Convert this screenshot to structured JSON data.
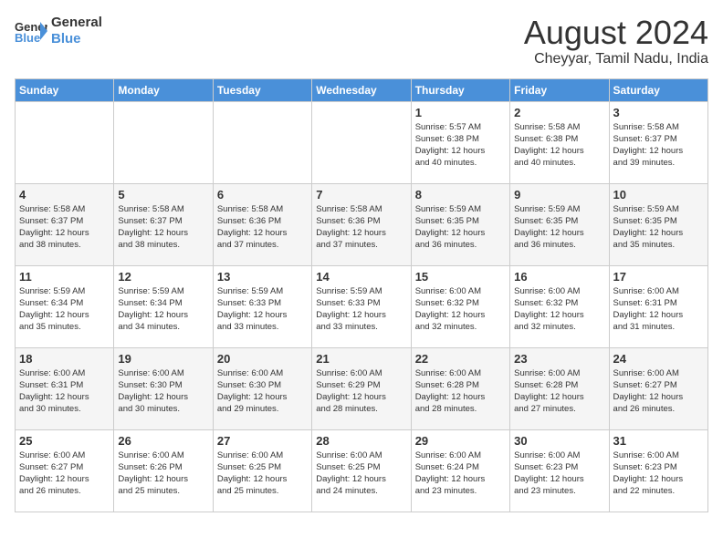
{
  "logo": {
    "line1": "General",
    "line2": "Blue"
  },
  "title": "August 2024",
  "subtitle": "Cheyyar, Tamil Nadu, India",
  "days_of_week": [
    "Sunday",
    "Monday",
    "Tuesday",
    "Wednesday",
    "Thursday",
    "Friday",
    "Saturday"
  ],
  "weeks": [
    [
      {
        "num": "",
        "info": ""
      },
      {
        "num": "",
        "info": ""
      },
      {
        "num": "",
        "info": ""
      },
      {
        "num": "",
        "info": ""
      },
      {
        "num": "1",
        "info": "Sunrise: 5:57 AM\nSunset: 6:38 PM\nDaylight: 12 hours\nand 40 minutes."
      },
      {
        "num": "2",
        "info": "Sunrise: 5:58 AM\nSunset: 6:38 PM\nDaylight: 12 hours\nand 40 minutes."
      },
      {
        "num": "3",
        "info": "Sunrise: 5:58 AM\nSunset: 6:37 PM\nDaylight: 12 hours\nand 39 minutes."
      }
    ],
    [
      {
        "num": "4",
        "info": "Sunrise: 5:58 AM\nSunset: 6:37 PM\nDaylight: 12 hours\nand 38 minutes."
      },
      {
        "num": "5",
        "info": "Sunrise: 5:58 AM\nSunset: 6:37 PM\nDaylight: 12 hours\nand 38 minutes."
      },
      {
        "num": "6",
        "info": "Sunrise: 5:58 AM\nSunset: 6:36 PM\nDaylight: 12 hours\nand 37 minutes."
      },
      {
        "num": "7",
        "info": "Sunrise: 5:58 AM\nSunset: 6:36 PM\nDaylight: 12 hours\nand 37 minutes."
      },
      {
        "num": "8",
        "info": "Sunrise: 5:59 AM\nSunset: 6:35 PM\nDaylight: 12 hours\nand 36 minutes."
      },
      {
        "num": "9",
        "info": "Sunrise: 5:59 AM\nSunset: 6:35 PM\nDaylight: 12 hours\nand 36 minutes."
      },
      {
        "num": "10",
        "info": "Sunrise: 5:59 AM\nSunset: 6:35 PM\nDaylight: 12 hours\nand 35 minutes."
      }
    ],
    [
      {
        "num": "11",
        "info": "Sunrise: 5:59 AM\nSunset: 6:34 PM\nDaylight: 12 hours\nand 35 minutes."
      },
      {
        "num": "12",
        "info": "Sunrise: 5:59 AM\nSunset: 6:34 PM\nDaylight: 12 hours\nand 34 minutes."
      },
      {
        "num": "13",
        "info": "Sunrise: 5:59 AM\nSunset: 6:33 PM\nDaylight: 12 hours\nand 33 minutes."
      },
      {
        "num": "14",
        "info": "Sunrise: 5:59 AM\nSunset: 6:33 PM\nDaylight: 12 hours\nand 33 minutes."
      },
      {
        "num": "15",
        "info": "Sunrise: 6:00 AM\nSunset: 6:32 PM\nDaylight: 12 hours\nand 32 minutes."
      },
      {
        "num": "16",
        "info": "Sunrise: 6:00 AM\nSunset: 6:32 PM\nDaylight: 12 hours\nand 32 minutes."
      },
      {
        "num": "17",
        "info": "Sunrise: 6:00 AM\nSunset: 6:31 PM\nDaylight: 12 hours\nand 31 minutes."
      }
    ],
    [
      {
        "num": "18",
        "info": "Sunrise: 6:00 AM\nSunset: 6:31 PM\nDaylight: 12 hours\nand 30 minutes."
      },
      {
        "num": "19",
        "info": "Sunrise: 6:00 AM\nSunset: 6:30 PM\nDaylight: 12 hours\nand 30 minutes."
      },
      {
        "num": "20",
        "info": "Sunrise: 6:00 AM\nSunset: 6:30 PM\nDaylight: 12 hours\nand 29 minutes."
      },
      {
        "num": "21",
        "info": "Sunrise: 6:00 AM\nSunset: 6:29 PM\nDaylight: 12 hours\nand 28 minutes."
      },
      {
        "num": "22",
        "info": "Sunrise: 6:00 AM\nSunset: 6:28 PM\nDaylight: 12 hours\nand 28 minutes."
      },
      {
        "num": "23",
        "info": "Sunrise: 6:00 AM\nSunset: 6:28 PM\nDaylight: 12 hours\nand 27 minutes."
      },
      {
        "num": "24",
        "info": "Sunrise: 6:00 AM\nSunset: 6:27 PM\nDaylight: 12 hours\nand 26 minutes."
      }
    ],
    [
      {
        "num": "25",
        "info": "Sunrise: 6:00 AM\nSunset: 6:27 PM\nDaylight: 12 hours\nand 26 minutes."
      },
      {
        "num": "26",
        "info": "Sunrise: 6:00 AM\nSunset: 6:26 PM\nDaylight: 12 hours\nand 25 minutes."
      },
      {
        "num": "27",
        "info": "Sunrise: 6:00 AM\nSunset: 6:25 PM\nDaylight: 12 hours\nand 25 minutes."
      },
      {
        "num": "28",
        "info": "Sunrise: 6:00 AM\nSunset: 6:25 PM\nDaylight: 12 hours\nand 24 minutes."
      },
      {
        "num": "29",
        "info": "Sunrise: 6:00 AM\nSunset: 6:24 PM\nDaylight: 12 hours\nand 23 minutes."
      },
      {
        "num": "30",
        "info": "Sunrise: 6:00 AM\nSunset: 6:23 PM\nDaylight: 12 hours\nand 23 minutes."
      },
      {
        "num": "31",
        "info": "Sunrise: 6:00 AM\nSunset: 6:23 PM\nDaylight: 12 hours\nand 22 minutes."
      }
    ]
  ]
}
